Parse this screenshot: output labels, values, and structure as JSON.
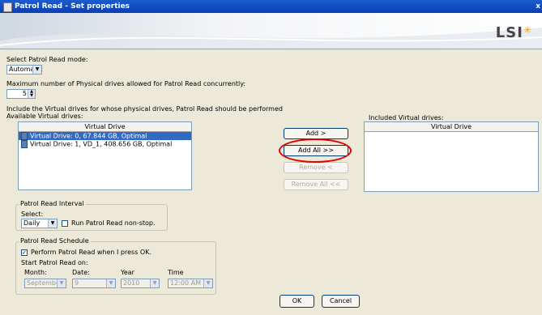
{
  "window": {
    "title": "Patrol Read - Set properties",
    "close_glyph": "x"
  },
  "banner": {
    "logo_text": "LSI",
    "logo_mark": "✳"
  },
  "mode": {
    "label": "Select Patrol Read mode:",
    "value": "Automatic"
  },
  "max_drives": {
    "label": "Maximum number of Physical drives allowed for Patrol Read concurrently:",
    "value": "5"
  },
  "include_label": "Include the Virtual drives for whose physical drives, Patrol Read should be performed",
  "available": {
    "label": "Available Virtual drives:",
    "column": "Virtual Drive",
    "rows": [
      "Virtual Drive: 0, 67.844 GB, Optimal",
      "Virtual Drive: 1, VD_1, 408.656 GB, Optimal"
    ]
  },
  "included": {
    "label": "Included Virtual drives:",
    "column": "Virtual Drive"
  },
  "buttons": {
    "add": "Add >",
    "add_all": "Add All >>",
    "remove": "Remove <",
    "remove_all": "Remove All <<",
    "ok": "OK",
    "cancel": "Cancel"
  },
  "interval": {
    "group_label": "Patrol Read Interval",
    "select_label": "Select:",
    "value": "Daily",
    "nonstop_label": "Run Patrol Read non-stop."
  },
  "schedule": {
    "group_label": "Patrol Read Schedule",
    "perform_label": "Perform Patrol Read when I press OK.",
    "start_label": "Start Patrol Read on:",
    "month_label": "Month:",
    "month_value": "September",
    "date_label": "Date:",
    "date_value": "9",
    "year_label": "Year",
    "year_value": "2010",
    "time_label": "Time",
    "time_value": "12:00 AM"
  }
}
